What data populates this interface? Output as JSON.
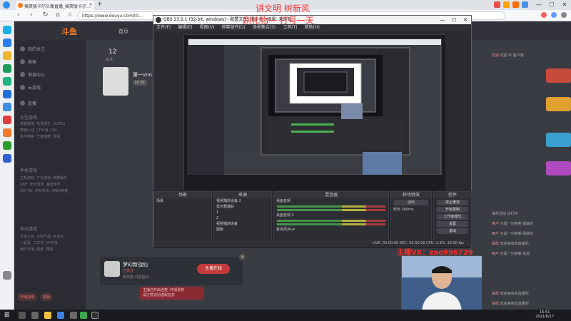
{
  "browser": {
    "tab_title": "搞笑版卡尔头像直播_搞笑版卡尔…",
    "tab_close": "×",
    "newtab_label": "+",
    "url": "https://www.douyu.com/t0...",
    "nav": {
      "back": "‹",
      "forward": "›",
      "reload": "↻",
      "home": "⌂",
      "star": "☆"
    },
    "window_controls": {
      "minimize": "—",
      "maximize": "☐",
      "close": "✕"
    }
  },
  "douyu": {
    "logo_text": "斗鱼",
    "nav_home": "首页",
    "sidebar": {
      "items": [
        "我的关注",
        "推荐",
        "消息中心",
        "云游戏"
      ],
      "section_live": "直播",
      "sections": [
        "大型游戏",
        "手机游戏",
        "休闲游戏"
      ],
      "grid_1": "英雄联盟  绝地求生  DOTA2\n穿越火线  CF手游  LOL\n和平精英  王者荣耀  逆战",
      "grid_2": "主机游戏  户外游戏  棋牌娱乐\nDNF  怀旧游戏  魔兽世界\nQQ飞车  炉石传说  APEX英雄",
      "grid_3": "方舟生存  主机产品  大逃杀\n一起看  二次元  CF手游\n娱乐天地  颜值  舞蹈",
      "footer_buttons": [
        "开播指南",
        "客服"
      ]
    },
    "anchor": {
      "fans": "12",
      "fans_label": "关注",
      "name": "第一vnn",
      "level": "LV 20"
    },
    "follow_card": {
      "name": "梦幻新战仙",
      "tag": "已关注",
      "sub": "有效期 内容提示",
      "button": "主播在线",
      "close": "×"
    },
    "notice": "主播已开启连麦  开通贵族\n请注意识别虚假信息",
    "chat": [
      {
        "user": "欢迎",
        "text": "欢迎 PC客户端"
      },
      {
        "user": "",
        "text": "抽奖活动 进行中"
      },
      {
        "user": "用户",
        "text": "只是一只被卷 歌曲也"
      },
      {
        "user": "用户",
        "text": "只是一只被卷 歌曲也"
      },
      {
        "user": "系统",
        "text": "欢迎来到本直播间"
      },
      {
        "user": "用户",
        "text": "只是一只被卷 欢迎"
      },
      {
        "user": "系统",
        "text": "欢迎来到本直播间"
      },
      {
        "user": "系统",
        "text": "欢迎来到本直播间"
      }
    ]
  },
  "obs": {
    "title": "OBS 23.2.1 (32-bit, windows) - 配置文件: 未命名 - 场景: 未命名",
    "menu": [
      "文件(F)",
      "编辑(E)",
      "视图(V)",
      "停靠部件(D)",
      "场景集合(S)",
      "工具(T)",
      "帮助(H)"
    ],
    "docks": {
      "scenes": {
        "title": "场景",
        "items": [
          "场景"
        ]
      },
      "sources": {
        "title": "来源",
        "items": [
          "视频捕获设备 2",
          "显示器捕获",
          "1",
          "2",
          "视频捕获设备",
          "图像"
        ]
      },
      "mixer": {
        "title": "混音器",
        "ch1": "桌面音频",
        "ch2": "桌面音频 2",
        "ch3": "麦克风/Aux"
      },
      "transitions": {
        "title": "转场特效",
        "type": "淡出",
        "duration_label": "时长",
        "duration": "300ms"
      },
      "controls": {
        "title": "控件",
        "buttons": [
          "停止推流",
          "开始录制",
          "工作室模式",
          "设置",
          "退出"
        ]
      }
    },
    "status": "LIVE: 00:00:00   REC: 00:00:00   CPU: 2.9%, 30.00 fps"
  },
  "overlay": {
    "line1": "讲文明 树新风",
    "line2": "刷礼物一 打号一天",
    "wechat": "主播VX：zao996729"
  },
  "taskbar": {
    "time": "15:51",
    "date": "2021/6/17",
    "start": "⊞"
  },
  "colors": {
    "douyu_orange": "#ff7a1a",
    "overlay_red": "#ff3030",
    "obs_bg": "#2a2b30"
  }
}
